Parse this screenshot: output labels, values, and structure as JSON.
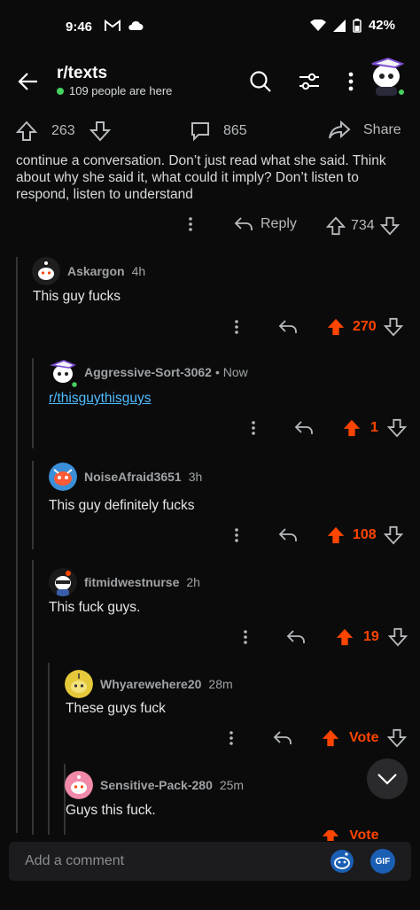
{
  "status_bar": {
    "time": "9:46",
    "battery": "42%"
  },
  "header": {
    "subreddit": "r/texts",
    "online_text": "109 people are here"
  },
  "post_bar": {
    "upvotes": "263",
    "comments": "865",
    "share_label": "Share"
  },
  "post_text": "continue a conversation. Don’t just read what she said. Think about why she said it, what could it imply? Don’t listen to respond, listen to understand",
  "post_actions": {
    "reply_label": "Reply",
    "score": "734"
  },
  "comments": [
    {
      "user": "Askargon",
      "time": "4h",
      "body": "This guy fucks",
      "score": "270"
    },
    {
      "user": "Aggressive-Sort-3062",
      "time": "• Now",
      "body": "r/thisguythisguys",
      "score": "1"
    },
    {
      "user": "NoiseAfraid3651",
      "time": "3h",
      "body": "This guy definitely fucks",
      "score": "108"
    },
    {
      "user": "fitmidwestnurse",
      "time": "2h",
      "body": "This fuck guys.",
      "score": "19"
    },
    {
      "user": "Whyarewehere20",
      "time": "28m",
      "body": "These guys fuck",
      "score": "Vote"
    },
    {
      "user": "Sensitive-Pack-280",
      "time": "25m",
      "body": "Guys this fuck.",
      "score": "Vote"
    }
  ],
  "composer": {
    "placeholder": "Add a comment",
    "gif_label": "GIF"
  },
  "colors": {
    "accent": "#ff4500",
    "link": "#4fbcff",
    "online": "#46d160"
  }
}
